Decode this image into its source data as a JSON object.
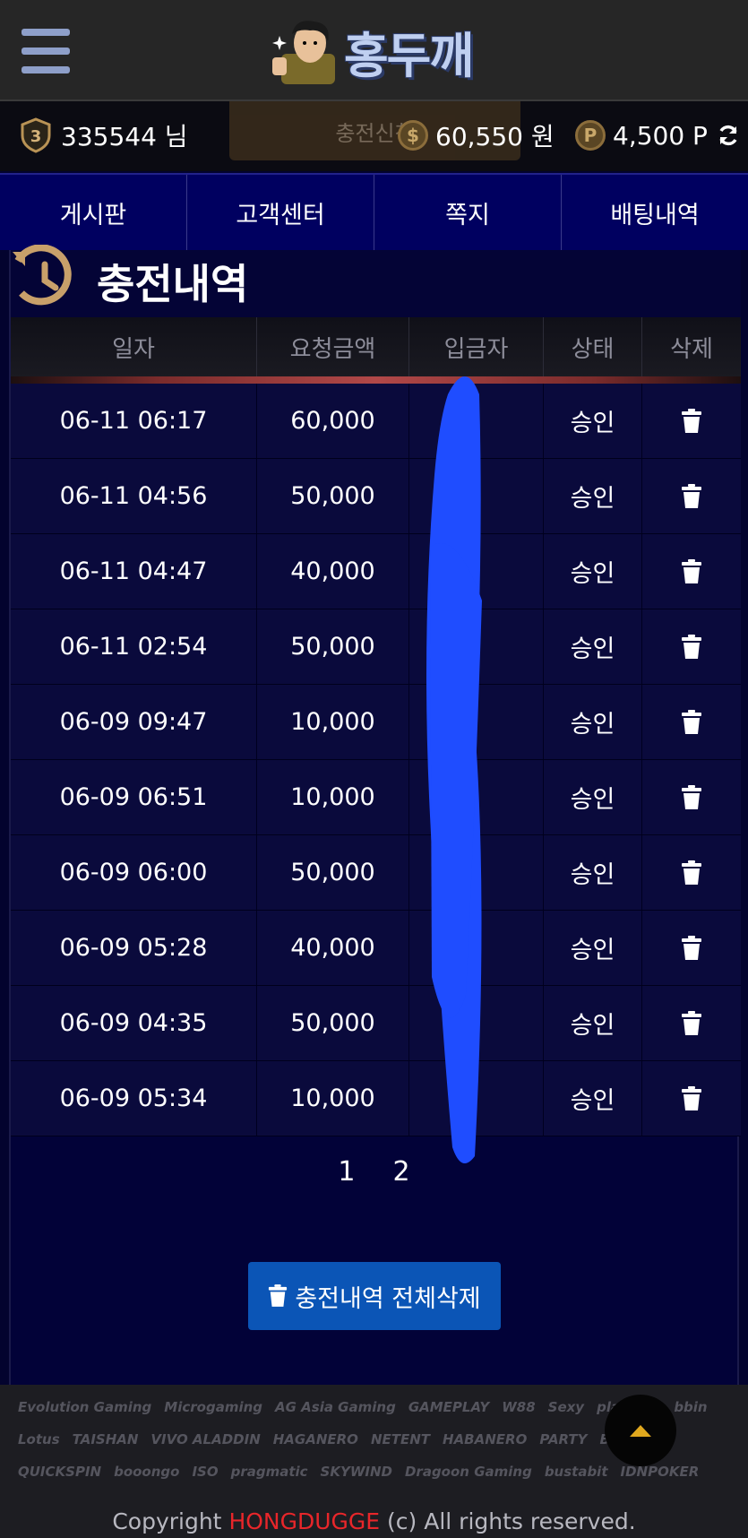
{
  "header": {
    "logo_text": "홍두깨",
    "menu_icon": "hamburger-icon"
  },
  "userbar": {
    "level": "3",
    "user": "335544 님",
    "charge_ghost": "충전신청",
    "money_symbol": "$",
    "money": "60,550 원",
    "point_symbol": "P",
    "point": "4,500 P"
  },
  "nav": {
    "tabs": [
      {
        "label": "게시판"
      },
      {
        "label": "고객센터"
      },
      {
        "label": "쪽지"
      },
      {
        "label": "배팅내역"
      }
    ]
  },
  "section": {
    "title": "충전내역"
  },
  "table": {
    "headers": [
      "일자",
      "요청금액",
      "입금자",
      "상태",
      "삭제"
    ],
    "rows": [
      {
        "date": "06-11 06:17",
        "amount": "60,000",
        "depositor": "",
        "status": "승인"
      },
      {
        "date": "06-11 04:56",
        "amount": "50,000",
        "depositor": "",
        "status": "승인"
      },
      {
        "date": "06-11 04:47",
        "amount": "40,000",
        "depositor": "",
        "status": "승인"
      },
      {
        "date": "06-11 02:54",
        "amount": "50,000",
        "depositor": "",
        "status": "승인"
      },
      {
        "date": "06-09 09:47",
        "amount": "10,000",
        "depositor": "",
        "status": "승인"
      },
      {
        "date": "06-09 06:51",
        "amount": "10,000",
        "depositor": "",
        "status": "승인"
      },
      {
        "date": "06-09 06:00",
        "amount": "50,000",
        "depositor": "",
        "status": "승인"
      },
      {
        "date": "06-09 05:28",
        "amount": "40,000",
        "depositor": "",
        "status": "승인"
      },
      {
        "date": "06-09 04:35",
        "amount": "50,000",
        "depositor": "",
        "status": "승인"
      },
      {
        "date": "06-09 05:34",
        "amount": "10,000",
        "depositor": "",
        "status": "승인"
      }
    ]
  },
  "pagination": {
    "pages": [
      "1",
      "2"
    ]
  },
  "actions": {
    "delete_all_label": "충전내역 전체삭제"
  },
  "footer": {
    "providers": [
      "Evolution Gaming",
      "Microgaming",
      "AG Asia Gaming",
      "GAMEPLAY",
      "W88",
      "Sexy",
      "playtech",
      "bbin",
      "Lotus",
      "TAISHAN",
      "VIVO ALADDIN",
      "HAGANERO",
      "NETENT",
      "HABANERO",
      "PARTY",
      "BETSOFT",
      "QUICKSPIN",
      "booongo",
      "ISO",
      "pragmatic",
      "SKYWIND",
      "Dragoon Gaming",
      "bustabit",
      "IDNPOKER"
    ],
    "copyright_prefix": "Copyright ",
    "copyright_brand": "HONGDUGGE",
    "copyright_suffix": " (c) All rights reserved."
  },
  "colors": {
    "nav_bg": "#000060",
    "content_bg": "#020238",
    "row_bg": "#0a0a3c",
    "delete_button": "#0b55b6",
    "brand_red": "#e8262a",
    "scribble_blue": "#1f4dff"
  }
}
